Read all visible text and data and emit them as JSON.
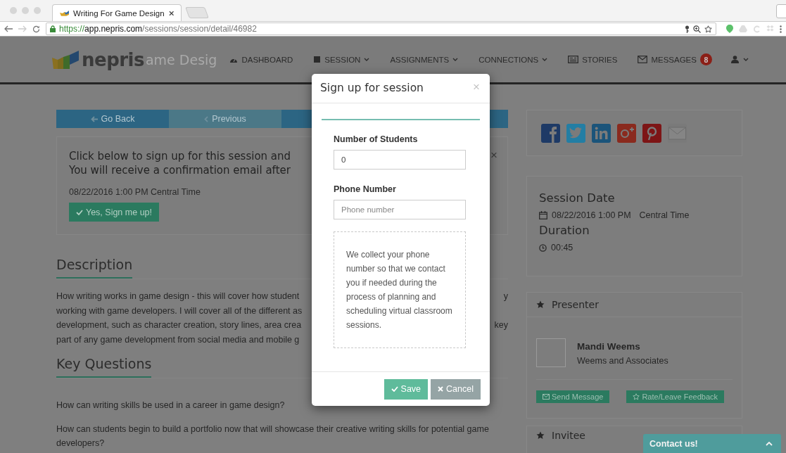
{
  "browser": {
    "tab_title": "Writing For Game Design",
    "url": {
      "scheme": "https://",
      "host": "app.nepris.com",
      "path": "/sessions/session/detail/46982"
    }
  },
  "navbar": {
    "logo": "nepris",
    "ghost_title": "ame Desig",
    "items": [
      {
        "label": "DASHBOARD",
        "dropdown": false
      },
      {
        "label": "SESSION",
        "dropdown": true
      },
      {
        "label": "ASSIGNMENTS",
        "dropdown": true
      },
      {
        "label": "CONNECTIONS",
        "dropdown": true
      },
      {
        "label": "STORIES",
        "dropdown": false
      },
      {
        "label": "MESSAGES",
        "badge": "8",
        "dropdown": false
      }
    ]
  },
  "nav_buttons": [
    {
      "label": "Go Back",
      "kind": "back"
    },
    {
      "label": "Previous",
      "kind": "previous"
    },
    {
      "kind": "next"
    }
  ],
  "alert": {
    "lines": [
      "Click below to sign up for this session and",
      "You will receive a confirmation email after"
    ],
    "close": "×",
    "date": "08/22/2016 1:00 PM Central Time",
    "button": "Yes, Sign me up!"
  },
  "description": {
    "heading": "Description",
    "lines": [
      {
        "left": "How writing works in game design - this will cover how student",
        "right": "y"
      },
      {
        "left": "working with game developers. I will cover all of the different as"
      },
      {
        "left": "development, such as character creation, story lines, area crea",
        "right": "key"
      },
      {
        "left": "part of any game development from social media and mobile g"
      }
    ]
  },
  "key_questions": {
    "heading": "Key Questions",
    "items": [
      "How can writing skills be used in a career in game design?",
      "How can students begin to build a portfolio now that will showcase their creative writing skills for potential game developers?"
    ]
  },
  "share": [
    {
      "kind": "facebook"
    },
    {
      "kind": "twitter"
    },
    {
      "kind": "linkedin"
    },
    {
      "kind": "googleplus"
    },
    {
      "kind": "pinterest"
    },
    {
      "kind": "email"
    }
  ],
  "session_info": {
    "date_heading": "Session Date",
    "date": "08/22/2016 1:00 PM",
    "timezone": "Central Time",
    "duration_heading": "Duration",
    "duration": "00:45"
  },
  "presenter": {
    "heading": "Presenter",
    "name": "Mandi Weems",
    "organization": "Weems and Associates",
    "buttons": [
      "Send Message",
      "Rate/Leave Feedback"
    ]
  },
  "invitee": {
    "heading": "Invitee"
  },
  "contact": {
    "label": "Contact us!"
  },
  "modal": {
    "title": "Sign up for session",
    "close": "×",
    "fields": [
      {
        "label": "Number of Students",
        "value": "0"
      },
      {
        "label": "Phone Number",
        "placeholder": "Phone number"
      }
    ],
    "note": "We collect your phone number so that we contact you if needed during the process of planning and scheduling virtual classroom sessions.",
    "save": "Save",
    "cancel": "Cancel"
  }
}
